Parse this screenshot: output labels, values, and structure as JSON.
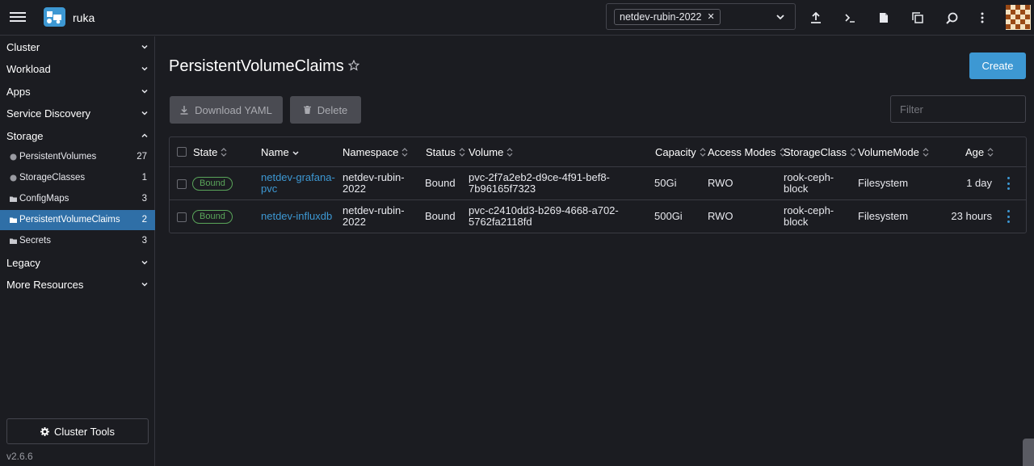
{
  "header": {
    "cluster_name": "ruka",
    "namespace_chip": "netdev-rubin-2022",
    "icons": [
      "import-yaml-icon",
      "kubectl-shell-icon",
      "kubeconfig-file-icon",
      "copy-kubeconfig-icon",
      "search-icon",
      "more-vert-icon"
    ]
  },
  "sidebar": {
    "groups": [
      {
        "label": "Cluster"
      },
      {
        "label": "Workload"
      },
      {
        "label": "Apps"
      },
      {
        "label": "Service Discovery"
      },
      {
        "label": "Storage"
      },
      {
        "label": "Legacy"
      },
      {
        "label": "More Resources"
      }
    ],
    "storage_items": [
      {
        "label": "PersistentVolumes",
        "count": "27",
        "icon": "circle-icon"
      },
      {
        "label": "StorageClasses",
        "count": "1",
        "icon": "circle-icon"
      },
      {
        "label": "ConfigMaps",
        "count": "3",
        "icon": "folder-icon"
      },
      {
        "label": "PersistentVolumeClaims",
        "count": "2",
        "icon": "folder-icon"
      },
      {
        "label": "Secrets",
        "count": "3",
        "icon": "folder-icon"
      }
    ],
    "cluster_tools": "Cluster Tools",
    "version": "v2.6.6"
  },
  "main": {
    "title": "PersistentVolumeClaims",
    "create_label": "Create",
    "download_label": "Download YAML",
    "delete_label": "Delete",
    "filter_placeholder": "Filter"
  },
  "table": {
    "columns": [
      "State",
      "Name",
      "Namespace",
      "Status",
      "Volume",
      "Capacity",
      "Access Modes",
      "StorageClass",
      "VolumeMode",
      "Age"
    ],
    "rows": [
      {
        "state": "Bound",
        "name_1": "netdev-grafana-",
        "name_2": "pvc",
        "namespace_1": "netdev-rubin-",
        "namespace_2": "2022",
        "status": "Bound",
        "volume_1": "pvc-2f7a2eb2-d9ce-4f91-bef8-",
        "volume_2": "7b96165f7323",
        "capacity": "50Gi",
        "access_modes": "RWO",
        "storage_class_1": "rook-ceph-",
        "storage_class_2": "block",
        "volume_mode": "Filesystem",
        "age": "1 day"
      },
      {
        "state": "Bound",
        "name_1": "netdev-influxdb",
        "name_2": "",
        "namespace_1": "netdev-rubin-",
        "namespace_2": "2022",
        "status": "Bound",
        "volume_1": "pvc-c2410dd3-b269-4668-a702-",
        "volume_2": "5762fa2118fd",
        "capacity": "500Gi",
        "access_modes": "RWO",
        "storage_class_1": "rook-ceph-",
        "storage_class_2": "block",
        "volume_mode": "Filesystem",
        "age": "23 hours"
      }
    ]
  },
  "colors": {
    "accent": "#3d98d3",
    "background": "#1b1c21",
    "active_nav": "#2f6fa7",
    "bound_badge": "#5aa55a"
  }
}
